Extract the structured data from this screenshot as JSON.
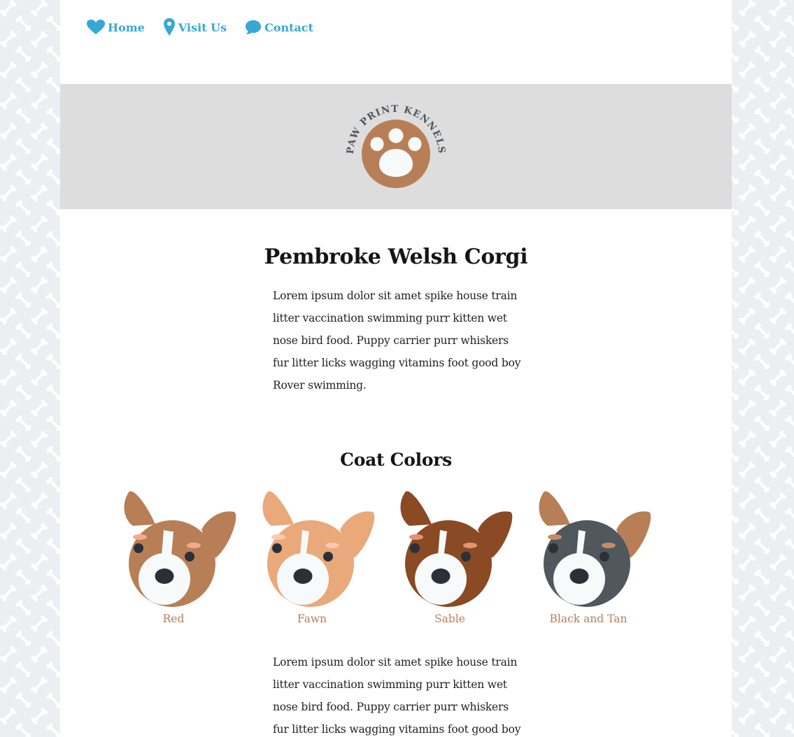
{
  "nav": {
    "items": [
      {
        "label": "Home",
        "icon": "heart-icon"
      },
      {
        "label": "Visit Us",
        "icon": "location-pin-icon"
      },
      {
        "label": "Contact",
        "icon": "speech-bubble-icon"
      }
    ]
  },
  "brand": {
    "name": "PAW PRINT KENNELS",
    "logo_icon": "paw-print-icon"
  },
  "main": {
    "title": "Pembroke Welsh Corgi",
    "intro": "Lorem ipsum dolor sit amet spike house train litter vaccination swimming purr kitten wet nose bird food. Puppy carrier purr whiskers fur litter licks wagging vitamins foot good boy Rover swimming.",
    "section_title": "Coat Colors",
    "body": "Lorem ipsum dolor sit amet spike house train litter vaccination swimming purr kitten wet nose bird food. Puppy carrier purr whiskers fur litter licks wagging vitamins foot good boy"
  },
  "coats": [
    {
      "label": "Red",
      "icon": "corgi-red-icon"
    },
    {
      "label": "Fawn",
      "icon": "corgi-fawn-icon"
    },
    {
      "label": "Sable",
      "icon": "corgi-sable-icon"
    },
    {
      "label": "Black and Tan",
      "icon": "corgi-black-tan-icon"
    }
  ],
  "colors": {
    "link": "#37a8d5",
    "accent": "#b87f5d",
    "hero_bg": "#dddddd",
    "logo_text": "#4f565d",
    "corgi_red": "#b87f56",
    "corgi_fawn": "#e9a97b",
    "corgi_sable": "#8a4a24",
    "corgi_black": "#50575d"
  }
}
